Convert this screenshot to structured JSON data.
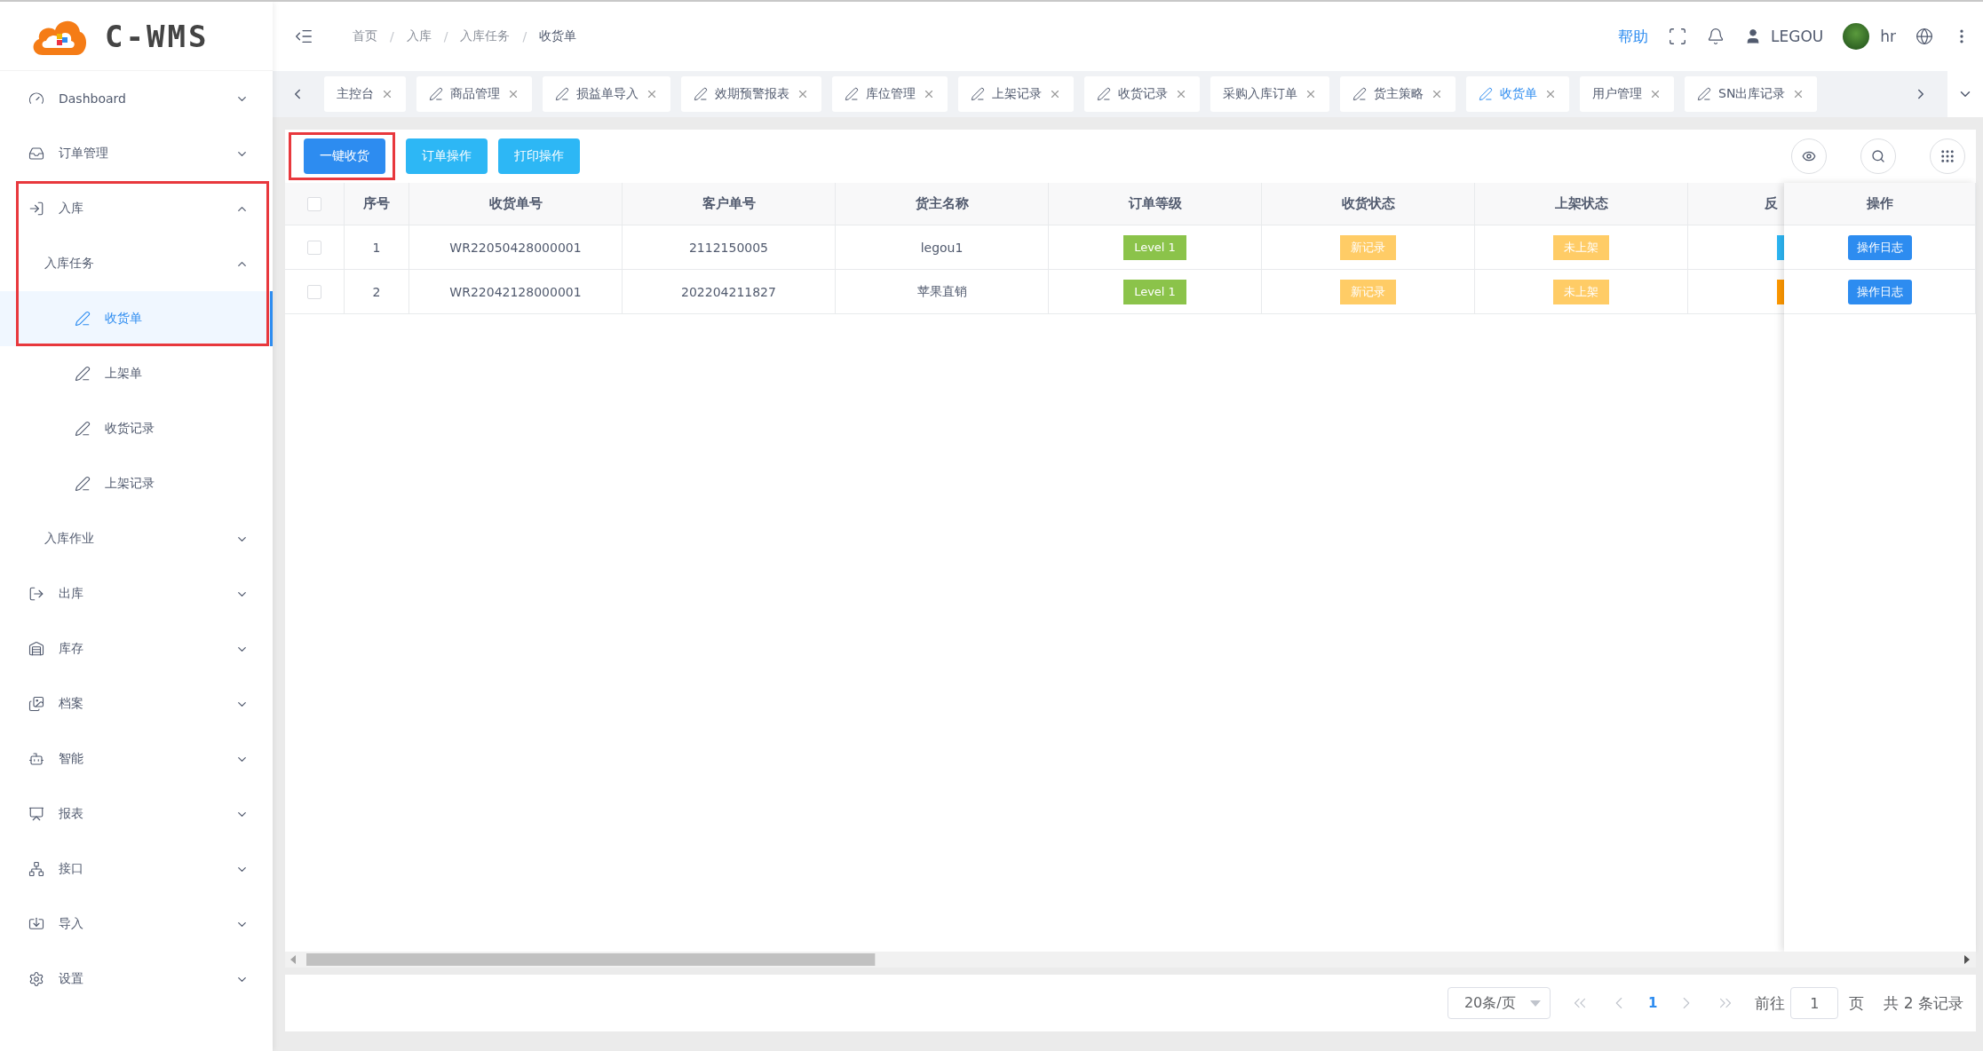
{
  "logo": {
    "text": "C-WMS"
  },
  "breadcrumb": {
    "items": [
      "首页",
      "入库",
      "入库任务",
      "收货单"
    ],
    "separators": [
      "/",
      "/",
      "/"
    ]
  },
  "header": {
    "help": "帮助",
    "user": "LEGOU",
    "account": "hr"
  },
  "tabs": [
    {
      "label": "主控台",
      "has_icon": false,
      "selected": false
    },
    {
      "label": "商品管理",
      "has_icon": true,
      "selected": false
    },
    {
      "label": "损益单导入",
      "has_icon": true,
      "selected": false
    },
    {
      "label": "效期预警报表",
      "has_icon": true,
      "selected": false
    },
    {
      "label": "库位管理",
      "has_icon": true,
      "selected": false
    },
    {
      "label": "上架记录",
      "has_icon": true,
      "selected": false
    },
    {
      "label": "收货记录",
      "has_icon": true,
      "selected": false
    },
    {
      "label": "采购入库订单",
      "has_icon": false,
      "selected": false
    },
    {
      "label": "货主策略",
      "has_icon": true,
      "selected": false
    },
    {
      "label": "收货单",
      "has_icon": true,
      "selected": true
    },
    {
      "label": "用户管理",
      "has_icon": false,
      "selected": false
    },
    {
      "label": "SN出库记录",
      "has_icon": true,
      "selected": false
    }
  ],
  "sidebar": {
    "items": [
      {
        "label": "Dashboard",
        "expanded": false,
        "highlighted": false
      },
      {
        "label": "订单管理",
        "expanded": false,
        "highlighted": false
      },
      {
        "label": "入库",
        "expanded": true,
        "highlighted": true,
        "children": [
          {
            "label": "入库任务",
            "expanded": true,
            "highlighted": true,
            "children": [
              {
                "label": "收货单",
                "selected": true,
                "highlighted": true
              },
              {
                "label": "上架单",
                "selected": false,
                "highlighted": false
              },
              {
                "label": "收货记录",
                "selected": false,
                "highlighted": false
              },
              {
                "label": "上架记录",
                "selected": false,
                "highlighted": false
              }
            ]
          },
          {
            "label": "入库作业",
            "expanded": false,
            "highlighted": false
          }
        ]
      },
      {
        "label": "出库",
        "expanded": false,
        "highlighted": false
      },
      {
        "label": "库存",
        "expanded": false,
        "highlighted": false
      },
      {
        "label": "档案",
        "expanded": false,
        "highlighted": false
      },
      {
        "label": "智能",
        "expanded": false,
        "highlighted": false
      },
      {
        "label": "报表",
        "expanded": false,
        "highlighted": false
      },
      {
        "label": "接口",
        "expanded": false,
        "highlighted": false
      },
      {
        "label": "导入",
        "expanded": false,
        "highlighted": false
      },
      {
        "label": "设置",
        "expanded": false,
        "highlighted": false
      }
    ]
  },
  "toolbar": [
    {
      "label": "一键收货",
      "kind": "primary",
      "highlighted": true
    },
    {
      "label": "订单操作",
      "kind": "info",
      "highlighted": false
    },
    {
      "label": "打印操作",
      "kind": "info",
      "highlighted": false
    }
  ],
  "table": {
    "all_checked": false,
    "columns": [
      "序号",
      "收货单号",
      "客户单号",
      "货主名称",
      "订单等级",
      "收货状态",
      "上架状态",
      "反"
    ],
    "action_column": "操作",
    "rows": [
      {
        "checked": false,
        "cells": [
          "1",
          "WR22050428000001",
          "2112150005",
          "legou1"
        ],
        "grade": "Level 1",
        "receive_status": "新记录",
        "shelf_status": "未上架",
        "column_9": {
          "color": "#2db7f5"
        },
        "action": "操作日志"
      },
      {
        "checked": false,
        "cells": [
          "2",
          "WR22042128000001",
          "202204211827",
          "苹果直销"
        ],
        "grade": "Level 1",
        "receive_status": "新记录",
        "shelf_status": "未上架",
        "column_9": {
          "color": "#ff9900"
        },
        "action": "操作日志"
      }
    ]
  },
  "pagination": {
    "page_size": "20条/页",
    "current": "1",
    "goto_label": "前往",
    "goto_value": "1",
    "page_unit": "页",
    "total": "共 2 条记录"
  }
}
